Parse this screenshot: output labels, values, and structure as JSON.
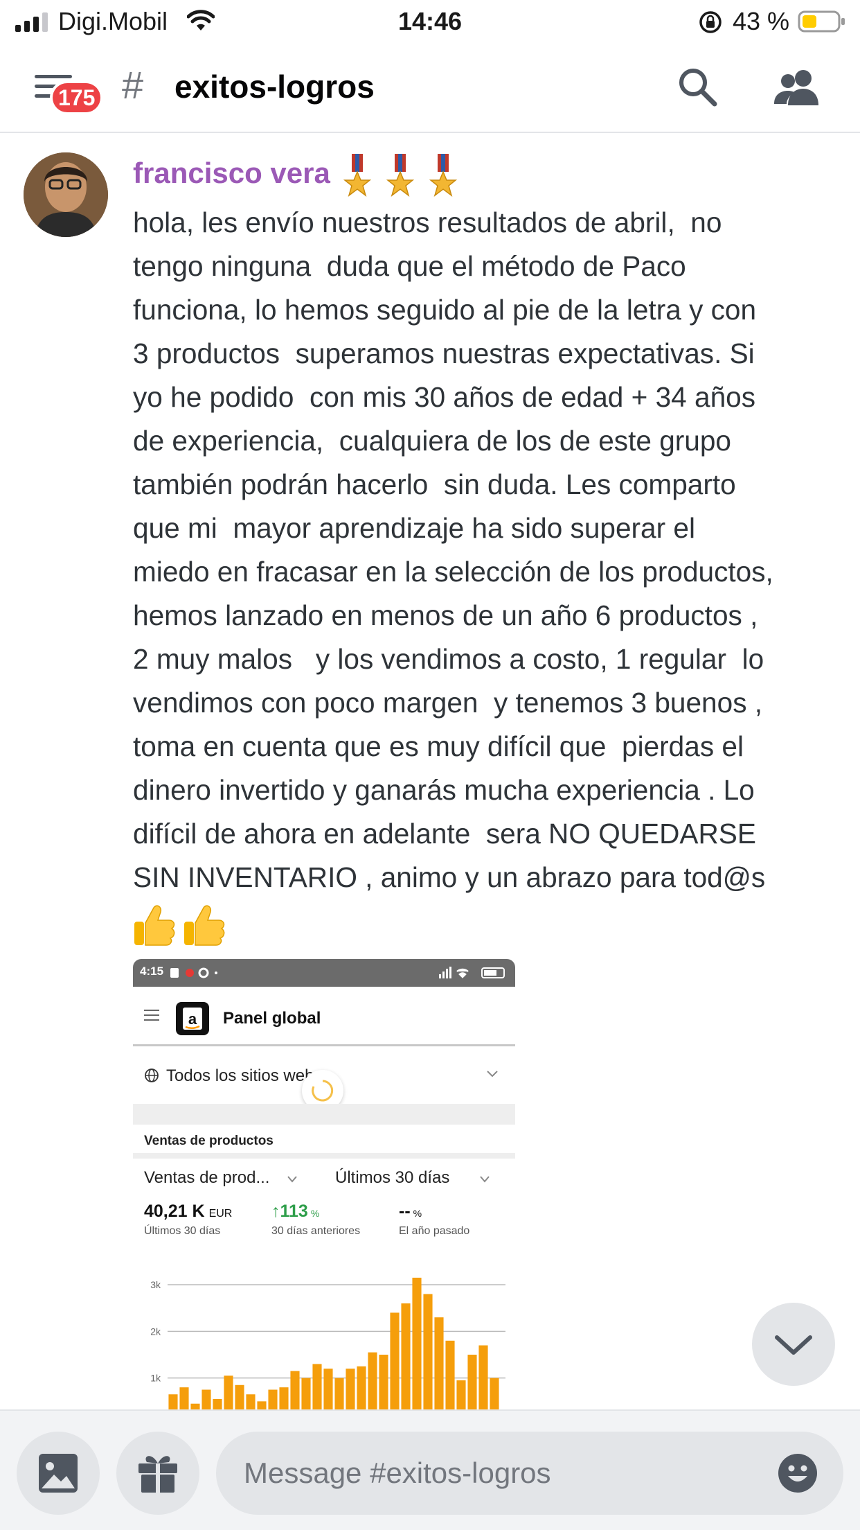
{
  "status_bar": {
    "carrier": "Digi.Mobil",
    "time": "14:46",
    "battery": "43 %"
  },
  "header": {
    "unread_badge": "175",
    "channel_name": "exitos-logros"
  },
  "message": {
    "author": "francisco vera",
    "author_color": "#9b59b6",
    "text": "hola, les envío nuestros resultados de abril,  no\ntengo ninguna  duda que el método de Paco\nfunciona, lo hemos seguido al pie de la letra y con\n3 productos  superamos nuestras expectativas. Si\nyo he podido  con mis 30 años de edad + 34 años\nde experiencia,  cualquiera de los de este grupo\ntambién podrán hacerlo  sin duda. Les comparto\nque mi  mayor aprendizaje ha sido superar el\nmiedo en fracasar en la selección de los productos,\nhemos lanzado en menos de un año 6 productos ,\n2 muy malos   y los vendimos a costo, 1 regular  lo\nvendimos con poco margen  y tenemos 3 buenos ,\ntoma en cuenta que es muy difícil que  pierdas el\ndinero invertido y ganarás mucha experiencia . Lo\ndifícil de ahora en adelante  sera NO QUEDARSE\nSIN INVENTARIO , animo y un abrazo para tod@s"
  },
  "attachment": {
    "status_time": "4:15",
    "title": "Panel global",
    "filter": "Todos los sitios web",
    "section": "Ventas de productos",
    "select_metric": "Ventas de prod...",
    "select_period": "Últimos 30 días",
    "kpis": [
      {
        "value": "40,21 K",
        "unit": "EUR",
        "label": "Últimos 30 días"
      },
      {
        "value": "↑113",
        "unit": "%",
        "label": "30 días anteriores",
        "color": "#2e9e4a"
      },
      {
        "value": "--",
        "unit": "%",
        "label": "El año pasado"
      }
    ],
    "chart_data": {
      "type": "bar",
      "bar_color": "#f59e0b",
      "ylim": [
        0,
        3000
      ],
      "yticks": [
        "1k",
        "2k",
        "3k"
      ],
      "values": [
        650,
        800,
        450,
        750,
        550,
        1050,
        850,
        650,
        500,
        750,
        800,
        1150,
        1000,
        1300,
        1200,
        1000,
        1200,
        1250,
        1550,
        1500,
        2400,
        2600,
        3150,
        2800,
        2300,
        1800,
        950,
        1500,
        1700,
        1000
      ]
    }
  },
  "composer": {
    "placeholder": "Message #exitos-logros"
  }
}
